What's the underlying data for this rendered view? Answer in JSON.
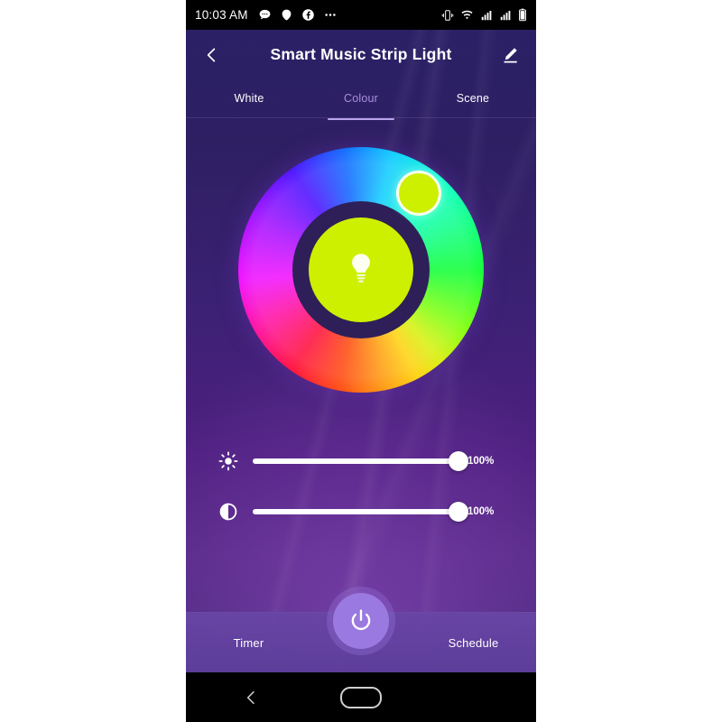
{
  "status_bar": {
    "time": "10:03 AM",
    "left_icons": [
      "messages-icon",
      "assistant-icon",
      "facebook-icon",
      "more-icon"
    ],
    "right_icons": [
      "vibrate-icon",
      "wifi-icon",
      "signal-icon",
      "signal-icon-2",
      "battery-icon"
    ]
  },
  "header": {
    "back_label": "back-chevron-icon",
    "title": "Smart Music Strip Light",
    "edit_label": "edit-pencil-icon"
  },
  "tabs": [
    {
      "label": "White",
      "active": false
    },
    {
      "label": "Colour",
      "active": true
    },
    {
      "label": "Scene",
      "active": false
    }
  ],
  "color_wheel": {
    "selected_color": "#ccf000",
    "handle_color": "#ccf000",
    "handle_angle_deg": 53,
    "inner_icon": "light-bulb-icon",
    "ring_outer_diameter": 272,
    "ring_inner_diameter": 152,
    "inner_disc_diameter": 116
  },
  "sliders": [
    {
      "name": "brightness",
      "icon": "brightness-sun-icon",
      "value": 100,
      "value_label": "100%"
    },
    {
      "name": "saturation",
      "icon": "contrast-half-circle-icon",
      "value": 100,
      "value_label": "100%"
    }
  ],
  "bottom_bar": {
    "timer_label": "Timer",
    "power_label": "power-icon",
    "power_color": "#9a79e0",
    "schedule_label": "Schedule"
  },
  "nav_bar": {
    "back": "nav-back-icon",
    "home": "nav-home-pill"
  }
}
